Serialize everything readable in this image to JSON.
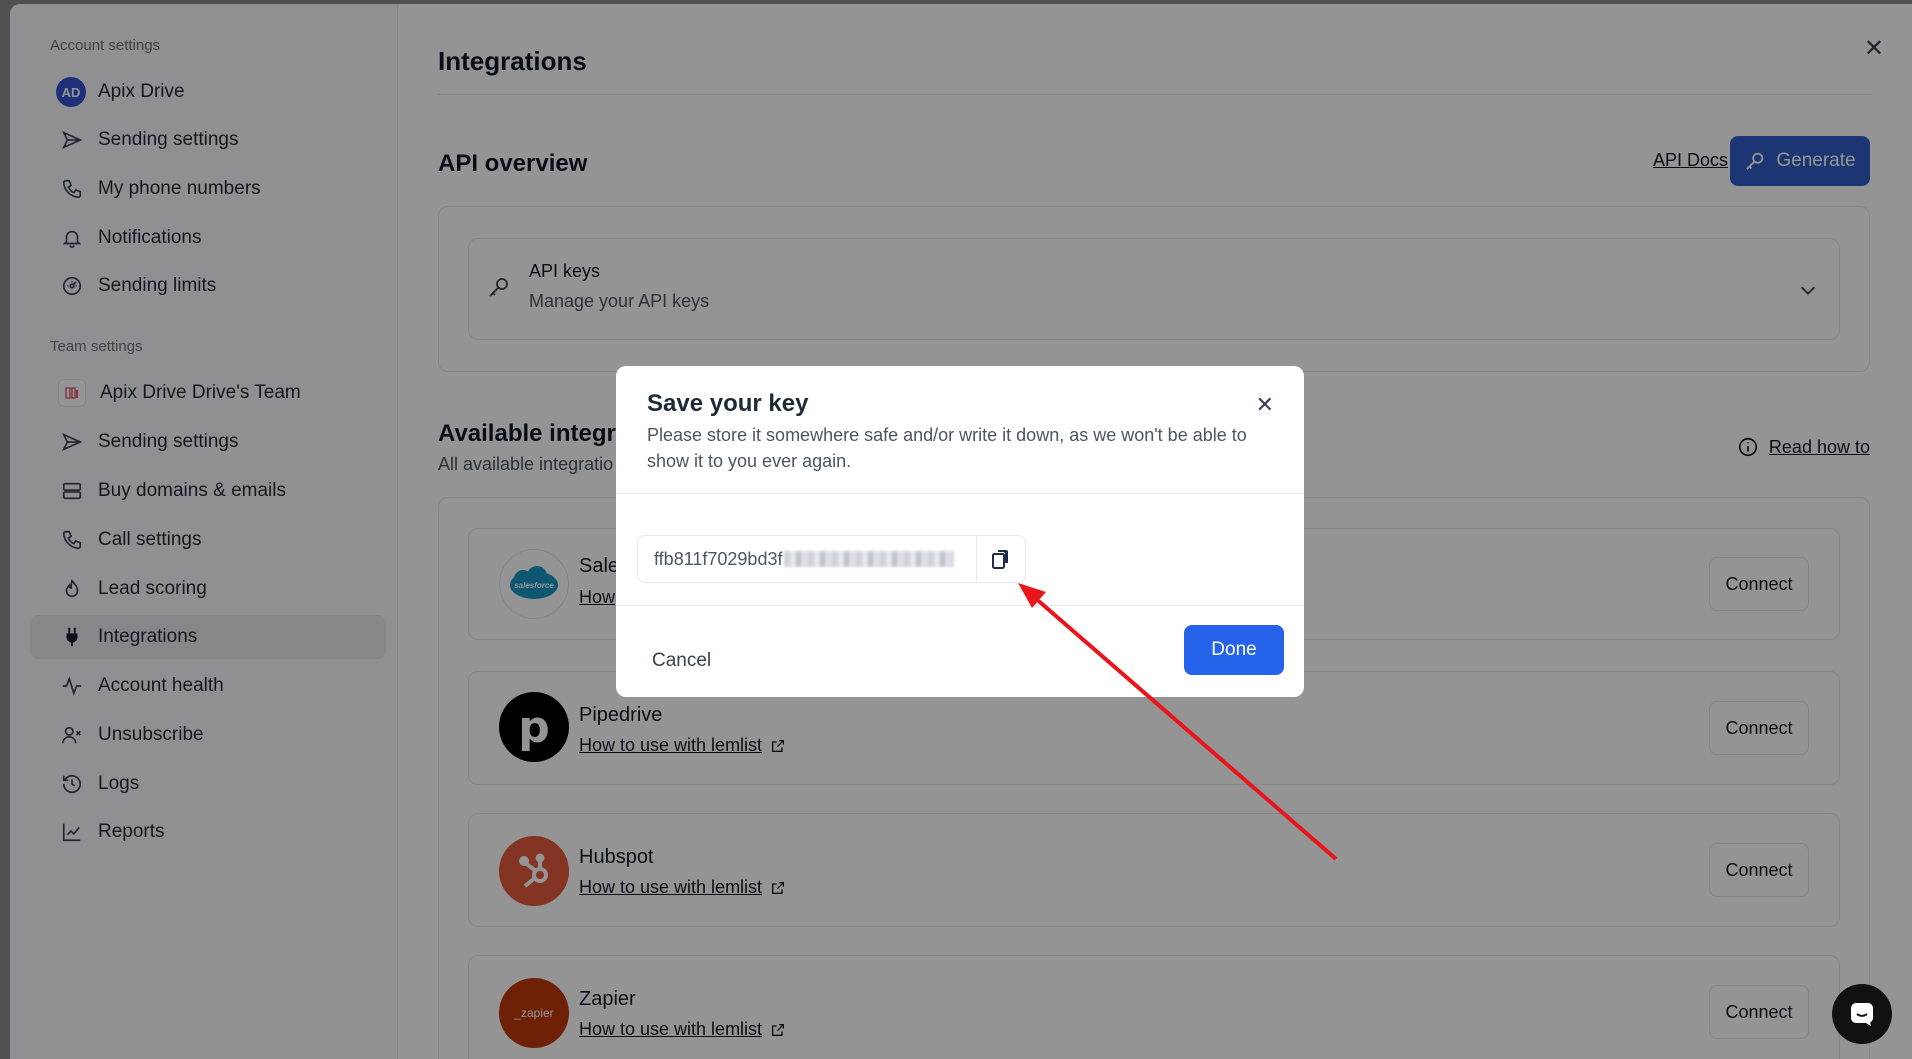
{
  "sidebar": {
    "account_section": "Account settings",
    "account_items": [
      {
        "label": "Apix Drive",
        "avatar": "AD"
      },
      {
        "label": "Sending settings"
      },
      {
        "label": "My phone numbers"
      },
      {
        "label": "Notifications"
      },
      {
        "label": "Sending limits"
      }
    ],
    "team_section": "Team settings",
    "team_items": [
      {
        "label": "Apix Drive Drive's Team"
      },
      {
        "label": "Sending settings"
      },
      {
        "label": "Buy domains & emails"
      },
      {
        "label": "Call settings"
      },
      {
        "label": "Lead scoring"
      },
      {
        "label": "Integrations",
        "active": true
      },
      {
        "label": "Account health"
      },
      {
        "label": "Unsubscribe"
      },
      {
        "label": "Logs"
      },
      {
        "label": "Reports"
      }
    ]
  },
  "main": {
    "title": "Integrations",
    "api_overview": {
      "title": "API overview",
      "docs_label": "API Docs",
      "generate_label": "Generate",
      "api_keys_title": "API keys",
      "api_keys_sub": "Manage your API keys"
    },
    "available": {
      "title": "Available integra",
      "subtitle": "All available integratio",
      "read_how": "Read how to",
      "items": [
        {
          "name": "Sale",
          "link": "How",
          "logo": "salesforce",
          "connect": "Connect"
        },
        {
          "name": "Pipedrive",
          "link": "How to use with lemlist",
          "logo": "p",
          "connect": "Connect"
        },
        {
          "name": "Hubspot",
          "link": "How to use with lemlist",
          "logo": "hubspot",
          "connect": "Connect"
        },
        {
          "name": "Zapier",
          "link": "How to use with lemlist",
          "logo": "_zapier",
          "connect": "Connect"
        }
      ]
    }
  },
  "modal": {
    "title": "Save your key",
    "description": "Please store it somewhere safe and/or write it down, as we won't be able to show it to you ever again.",
    "key_visible": "ffb811f7029bd3f",
    "cancel_label": "Cancel",
    "done_label": "Done"
  },
  "colors": {
    "accent": "#2563eb",
    "generate": "#2f5ec6",
    "annotation_arrow": "#e8161b"
  }
}
